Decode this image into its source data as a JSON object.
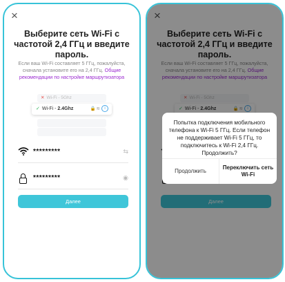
{
  "screen": {
    "close_glyph": "×",
    "title": "Выберите сеть Wi-Fi с частотой 2,4 ГГц и введите пароль.",
    "description": "Если ваш Wi-Fi составляет 5 ГГц, пожалуйста, сначала установите его на 2,4 ГГц.",
    "description_link": "Общие рекомендации по настройке маршрутизатора",
    "illustration": {
      "network_5ghz": "Wi-Fi - 5Ghz",
      "network_24_prefix": "Wi-Fi - ",
      "network_24_bold": "2.4Ghz"
    },
    "wifi_field": {
      "value": "*********",
      "icon": "wifi-icon"
    },
    "password_field": {
      "value": "*********",
      "icon": "lock-icon"
    },
    "next_button": "Далее"
  },
  "dialog": {
    "message": "Попытка подключения мобильного телефона к Wi-Fi 5 ГГц. Если телефон не поддерживает Wi-Fi 5 ГГц, то подключитесь к Wi-Fi 2,4 ГГц. Продолжить?",
    "cancel_label": "Продолжить",
    "switch_label": "Переключить сеть Wi-Fi"
  },
  "colors": {
    "accent": "#3fc6d9",
    "frame": "#37c3d8",
    "link": "#9b2bd0",
    "check": "#2fb35a",
    "error": "#e8534f"
  }
}
